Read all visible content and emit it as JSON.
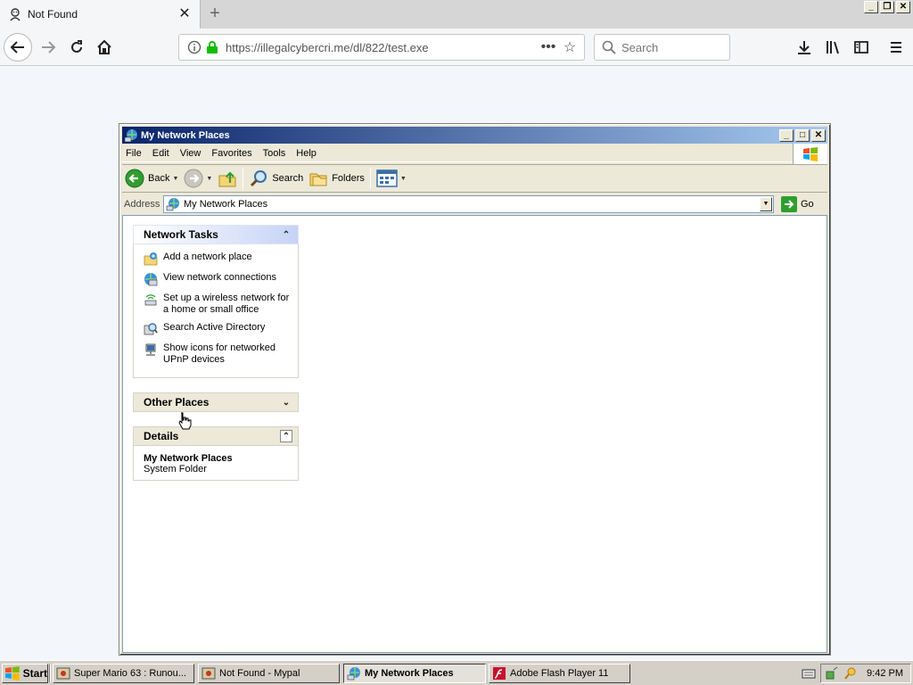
{
  "browser": {
    "tab_title": "Not Found",
    "new_tab": "+",
    "url": "https://illegalcybercri.me/dl/822/test.exe",
    "search_placeholder": "Search",
    "more_actions": "•••"
  },
  "window": {
    "title": "My Network Places",
    "menu": [
      "File",
      "Edit",
      "View",
      "Favorites",
      "Tools",
      "Help"
    ],
    "toolbar": {
      "back": "Back",
      "search": "Search",
      "folders": "Folders"
    },
    "address": {
      "label": "Address",
      "value": "My Network Places",
      "go": "Go"
    }
  },
  "tasks": {
    "network_tasks": {
      "title": "Network Tasks",
      "links": [
        {
          "label": "Add a network place",
          "icon": "add-network-place-icon"
        },
        {
          "label": "View network connections",
          "icon": "network-connections-icon"
        },
        {
          "label": "Set up a wireless network for a home or small office",
          "icon": "wireless-network-icon"
        },
        {
          "label": "Search Active Directory",
          "icon": "search-directory-icon"
        },
        {
          "label": "Show icons for networked UPnP devices",
          "icon": "upnp-devices-icon"
        }
      ]
    },
    "other_places": {
      "title": "Other Places"
    },
    "details": {
      "title": "Details",
      "name": "My Network Places",
      "type": "System Folder"
    }
  },
  "taskbar": {
    "start": "Start",
    "buttons": [
      {
        "label": "Super Mario 63 : Runou...",
        "active": false
      },
      {
        "label": "Not Found - Mypal",
        "active": false
      },
      {
        "label": "My Network Places",
        "active": true
      },
      {
        "label": "Adobe Flash Player 11",
        "active": false
      }
    ],
    "clock": "9:42 PM"
  },
  "colors": {
    "title_gradient_start": "#0a246a",
    "title_gradient_end": "#a6caf0",
    "lock_green": "#12bc00",
    "xp_face": "#ece9d8"
  }
}
